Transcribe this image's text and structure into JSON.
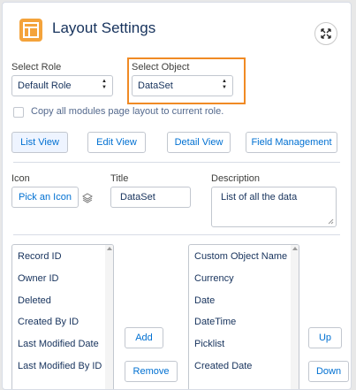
{
  "header": {
    "title": "Layout Settings",
    "app_icon": "layout-icon",
    "expand_icon": "expand-icon"
  },
  "role": {
    "label": "Select Role",
    "value": "Default Role"
  },
  "object": {
    "label": "Select Object",
    "value": "DataSet"
  },
  "copy_checkbox": {
    "label": "Copy all modules page layout to current role.",
    "checked": false
  },
  "view_buttons": [
    "List View",
    "Edit View",
    "Detail View",
    "Field Management"
  ],
  "icon_field": {
    "label": "Icon",
    "button": "Pick an Icon"
  },
  "title_field": {
    "label": "Title",
    "value": "DataSet"
  },
  "description_field": {
    "label": "Description",
    "value": "List of all the data"
  },
  "available_fields": [
    "Record ID",
    "Owner ID",
    "Deleted",
    "Created By ID",
    "Last Modified Date",
    "Last Modified By ID"
  ],
  "selected_fields": [
    "Custom Object Name",
    "Currency",
    "Date",
    "DateTime",
    "Picklist",
    "Created Date"
  ],
  "transfer_buttons": {
    "add": "Add",
    "remove": "Remove"
  },
  "order_buttons": {
    "up": "Up",
    "down": "Down"
  },
  "colors": {
    "accent": "#f4a33b",
    "highlight": "#f08a24",
    "link": "#0070d2"
  }
}
